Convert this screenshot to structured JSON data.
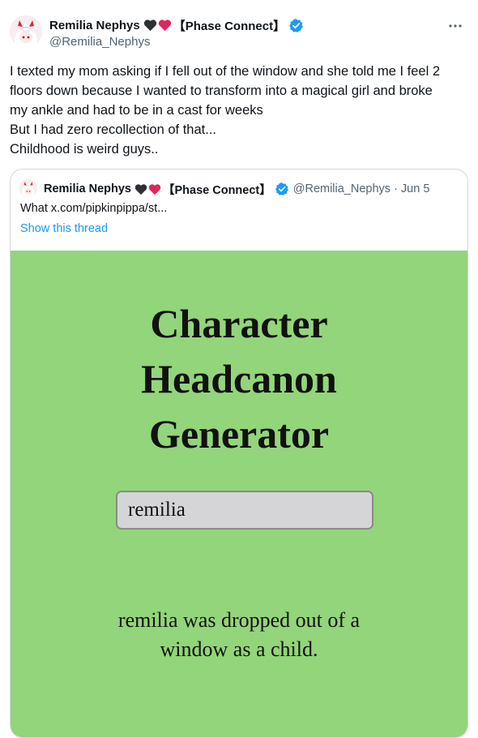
{
  "author": {
    "display_name": "Remilia Nephys",
    "affiliation": "【Phase Connect】",
    "handle": "@Remilia_Nephys",
    "hearts": [
      "black-heart",
      "red-heart"
    ],
    "verified": true,
    "verified_color": "#1d9bf0"
  },
  "tweet": {
    "lines": [
      "I texted my mom asking if I fell out of the window and she told me I feel 2",
      "floors down because I wanted to transform into a magical girl and broke",
      "my ankle and had to be in a cast for weeks",
      "But I had zero recollection of that...",
      "Childhood is weird guys.."
    ]
  },
  "quote": {
    "display_name": "Remilia Nephys",
    "affiliation": "【Phase Connect】",
    "handle_date": "@Remilia_Nephys · Jun 5",
    "text": "What  x.com/pipkinpippa/st...",
    "show_thread": "Show this thread",
    "image": {
      "background": "#93d57a",
      "title_lines": [
        "Character",
        "Headcanon",
        "Generator"
      ],
      "input_value": "remilia",
      "result_lines": [
        "remilia was dropped out of a",
        "window as a child."
      ]
    }
  },
  "colors": {
    "text": "#0f1419",
    "secondary": "#536471",
    "link": "#1d9bf0",
    "border": "#cfd9de",
    "heart_red": "#f91880"
  }
}
